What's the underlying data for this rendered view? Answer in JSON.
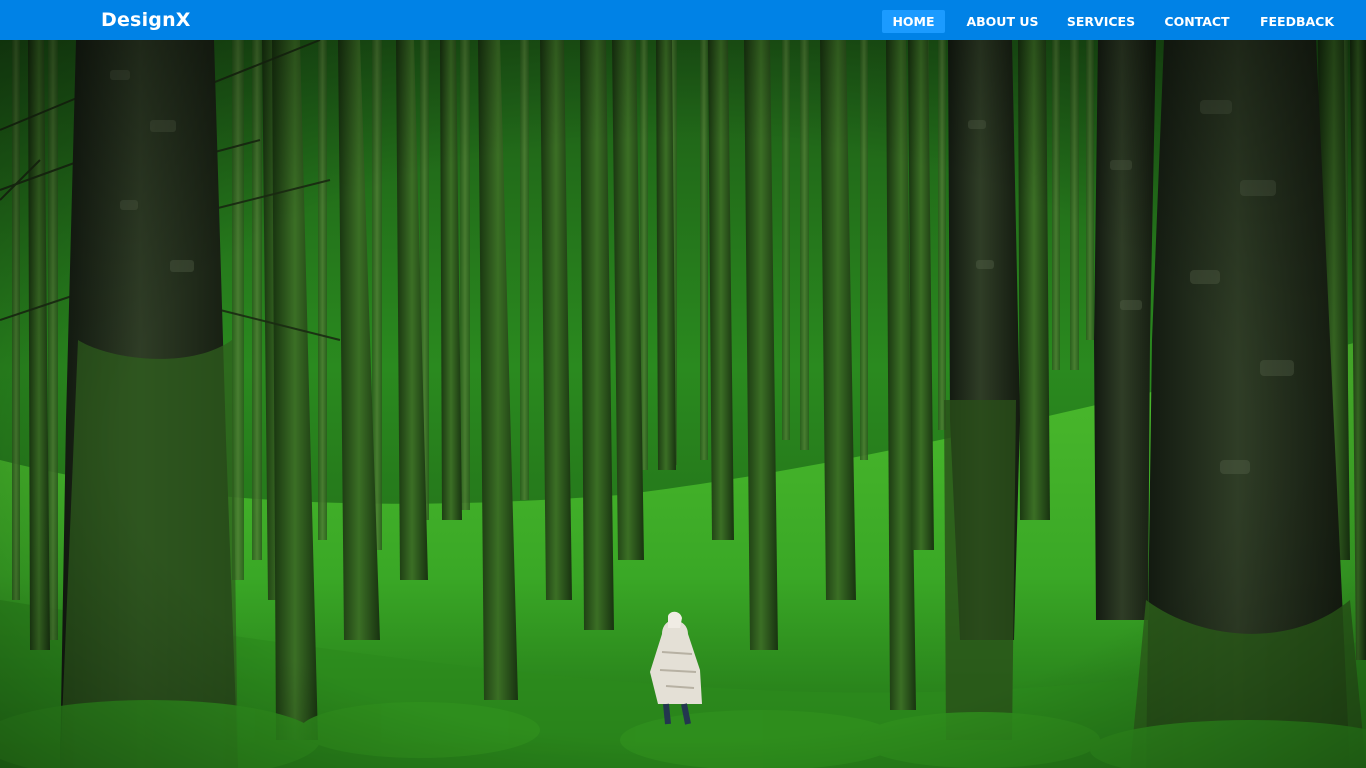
{
  "header": {
    "brand": "DesignX",
    "accent_color": "#0082e6",
    "active_color": "#1b9bff"
  },
  "nav": {
    "items": [
      {
        "label": "HOME",
        "active": true
      },
      {
        "label": "ABOUT US",
        "active": false
      },
      {
        "label": "SERVICES",
        "active": false
      },
      {
        "label": "CONTACT",
        "active": false
      },
      {
        "label": "FEEDBACK",
        "active": false
      }
    ]
  },
  "hero": {
    "image_subject": "forest-with-hooded-walker",
    "palette": {
      "moss": "#3fae2a",
      "moss_dark": "#1f6b17",
      "canopy": "#2e8f21",
      "bark_dark": "#1b2216",
      "bark_mid": "#2f3a26"
    }
  }
}
